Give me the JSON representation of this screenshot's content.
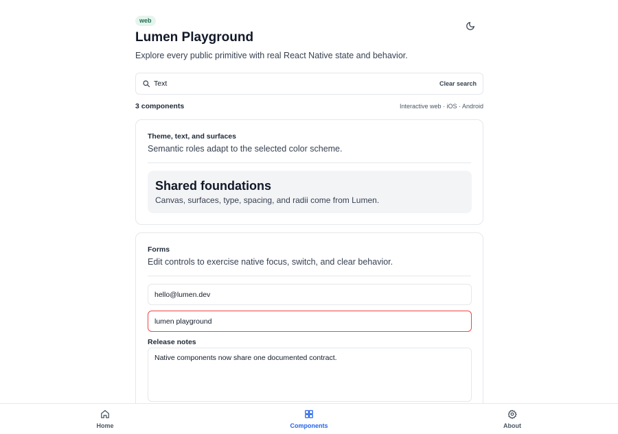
{
  "header": {
    "platform_badge": "web",
    "title": "Lumen Playground",
    "subtitle": "Explore every public primitive with real React Native state and behavior.",
    "theme_toggle_icon": "moon-icon"
  },
  "search": {
    "value": "Text",
    "clear_label": "Clear search"
  },
  "results": {
    "count_label": "3 components",
    "platform_note": "Interactive web · iOS · Android"
  },
  "cards": {
    "theme": {
      "title": "Theme, text, and surfaces",
      "description": "Semantic roles adapt to the selected color scheme.",
      "surface_title": "Shared foundations",
      "surface_description": "Canvas, surfaces, type, spacing, and radii come from Lumen."
    },
    "forms": {
      "title": "Forms",
      "description": "Edit controls to exercise native focus, switch, and clear behavior.",
      "email_value": "hello@lumen.dev",
      "name_value": "lumen playground",
      "release_notes_label": "Release notes",
      "release_notes_value": "Native components now share one documented contract."
    }
  },
  "tabbar": {
    "items": [
      {
        "label": "Home",
        "icon": "home-icon"
      },
      {
        "label": "Components",
        "icon": "components-icon",
        "active": true
      },
      {
        "label": "About",
        "icon": "gear-icon"
      }
    ]
  },
  "colors": {
    "accent": "#2563eb",
    "badge_bg": "#e6f4ee",
    "badge_text": "#1f6f4f",
    "error": "#ef4444",
    "border": "#e5e7eb"
  }
}
